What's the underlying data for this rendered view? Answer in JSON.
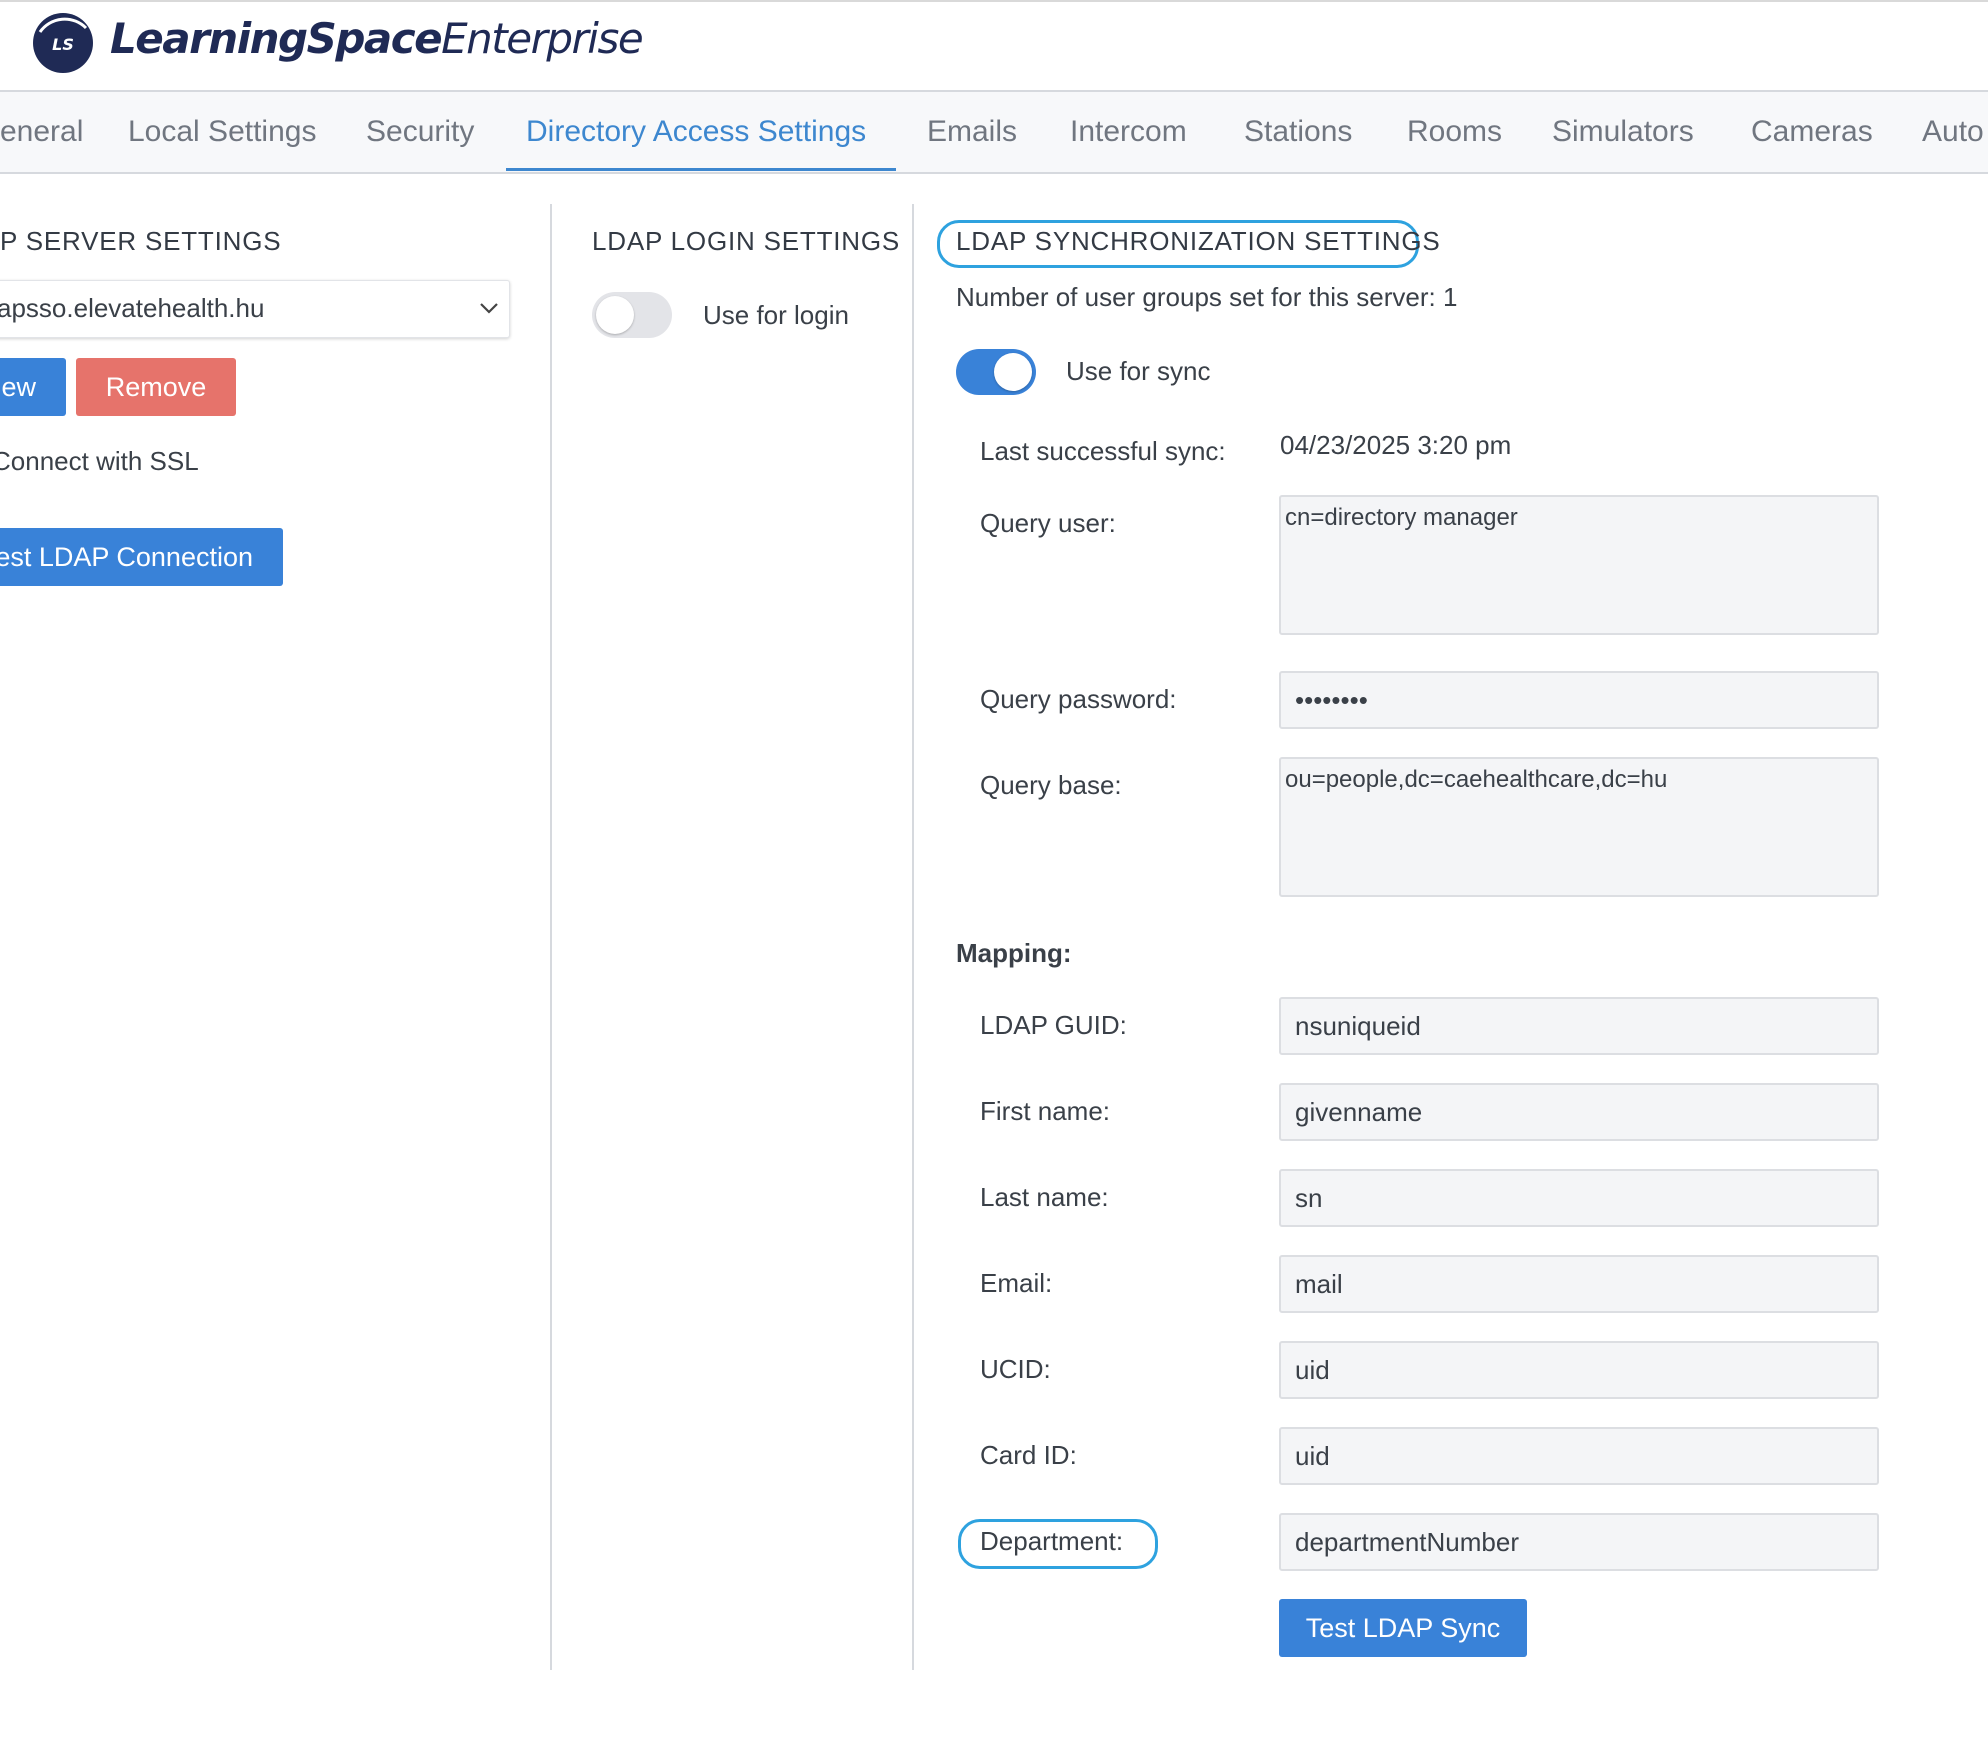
{
  "colors": {
    "accent": "#3d87cf",
    "primary_button": "#3982d8",
    "danger_button": "#e6736b",
    "highlight": "#2ea2df",
    "brand_navy": "#1f2a55"
  },
  "logo": {
    "mark": "LS",
    "name_bold": "LearningSpace",
    "name_light": "Enterprise"
  },
  "tabs": [
    {
      "label": "eneral"
    },
    {
      "label": "Local Settings"
    },
    {
      "label": "Security"
    },
    {
      "label": "Directory Access Settings",
      "active": true
    },
    {
      "label": "Emails"
    },
    {
      "label": "Intercom"
    },
    {
      "label": "Stations"
    },
    {
      "label": "Rooms"
    },
    {
      "label": "Simulators"
    },
    {
      "label": "Cameras"
    },
    {
      "label": "Auto"
    }
  ],
  "server": {
    "title": "P SERVER SETTINGS",
    "selected_server": "apsso.elevatehealth.hu",
    "new_button": "ew",
    "remove_button": "Remove",
    "ssl_label": "Connect with SSL",
    "test_button": "est LDAP Connection"
  },
  "login": {
    "title": "LDAP LOGIN SETTINGS",
    "use_for_login": "Use for login",
    "use_for_login_enabled": false
  },
  "sync": {
    "title": "LDAP SYNCHRONIZATION SETTINGS",
    "groups_info": "Number of user groups set for this server: 1",
    "use_for_sync": "Use for sync",
    "use_for_sync_enabled": true,
    "last_sync_label": "Last successful sync:",
    "last_sync_value": "04/23/2025 3:20 pm",
    "query_user_label": "Query user:",
    "query_user_value": "cn=directory manager",
    "query_password_label": "Query password:",
    "query_password_value": "••••••••",
    "query_base_label": "Query base:",
    "query_base_value": "ou=people,dc=caehealthcare,dc=hu",
    "mapping_label": "Mapping:",
    "mapping": {
      "guid_label": "LDAP GUID:",
      "guid_value": "nsuniqueid",
      "first_label": "First name:",
      "first_value": "givenname",
      "last_label": "Last name:",
      "last_value": "sn",
      "email_label": "Email:",
      "email_value": "mail",
      "ucid_label": "UCID:",
      "ucid_value": "uid",
      "card_label": "Card ID:",
      "card_value": "uid",
      "dept_label": "Department:",
      "dept_value": "departmentNumber"
    },
    "test_sync_button": "Test LDAP Sync"
  }
}
